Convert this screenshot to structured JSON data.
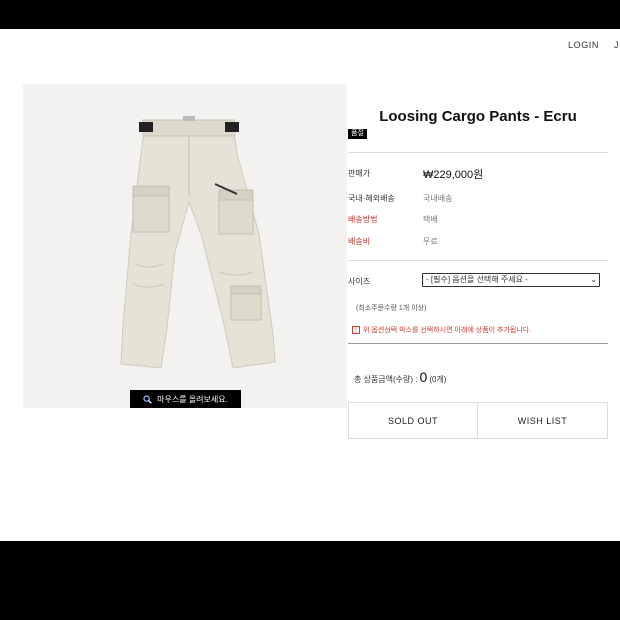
{
  "header": {
    "login": "LOGIN",
    "join": "J"
  },
  "product": {
    "image_alt": "Loosing Cargo Pants - Ecru product photo",
    "zoom_hint": "마우스를 올려보세요.",
    "title": "Loosing Cargo Pants - Ecru",
    "badge": "품절",
    "rows": [
      {
        "label": "판매가",
        "value": "₩229,000원"
      },
      {
        "label": "국내·해외배송",
        "value": "국내배송"
      },
      {
        "label": "배송방법",
        "value": "택배"
      },
      {
        "label": "배송비",
        "value": "무료"
      }
    ],
    "option": {
      "label": "사이즈",
      "selected": "- [필수] 옵션을 선택해 주세요 -"
    },
    "min_qty": "(최소주문수량 1개 이상)",
    "notice": "위 옵션선택 박스를 선택하시면 아래에 상품이 추가됩니다.",
    "total": {
      "label": "총 상품금액(수량) :",
      "amount": "0",
      "qty": "(0개)"
    },
    "buttons": {
      "sold_out": "SOLD OUT",
      "wish_list": "WISH LIST"
    }
  }
}
